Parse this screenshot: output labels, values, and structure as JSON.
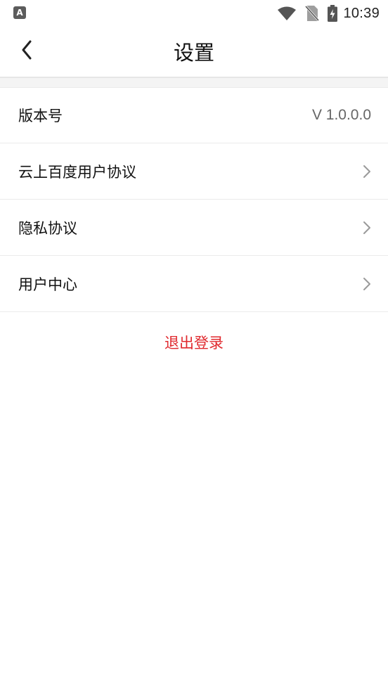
{
  "status_bar": {
    "left_icon_glyph": "A",
    "time": "10:39",
    "icons": [
      "wifi-icon",
      "no-sim-icon",
      "battery-charging-icon"
    ]
  },
  "header": {
    "back_icon": "chevron-left-icon",
    "title": "设置"
  },
  "settings": {
    "items": [
      {
        "label": "版本号",
        "value": "V 1.0.0.0"
      },
      {
        "label": "云上百度用户协议",
        "icon": "chevron-right-icon"
      },
      {
        "label": "隐私协议",
        "icon": "chevron-right-icon"
      },
      {
        "label": "用户中心",
        "icon": "chevron-right-icon"
      }
    ]
  },
  "logout": {
    "label": "退出登录",
    "color": "#e0292e"
  }
}
